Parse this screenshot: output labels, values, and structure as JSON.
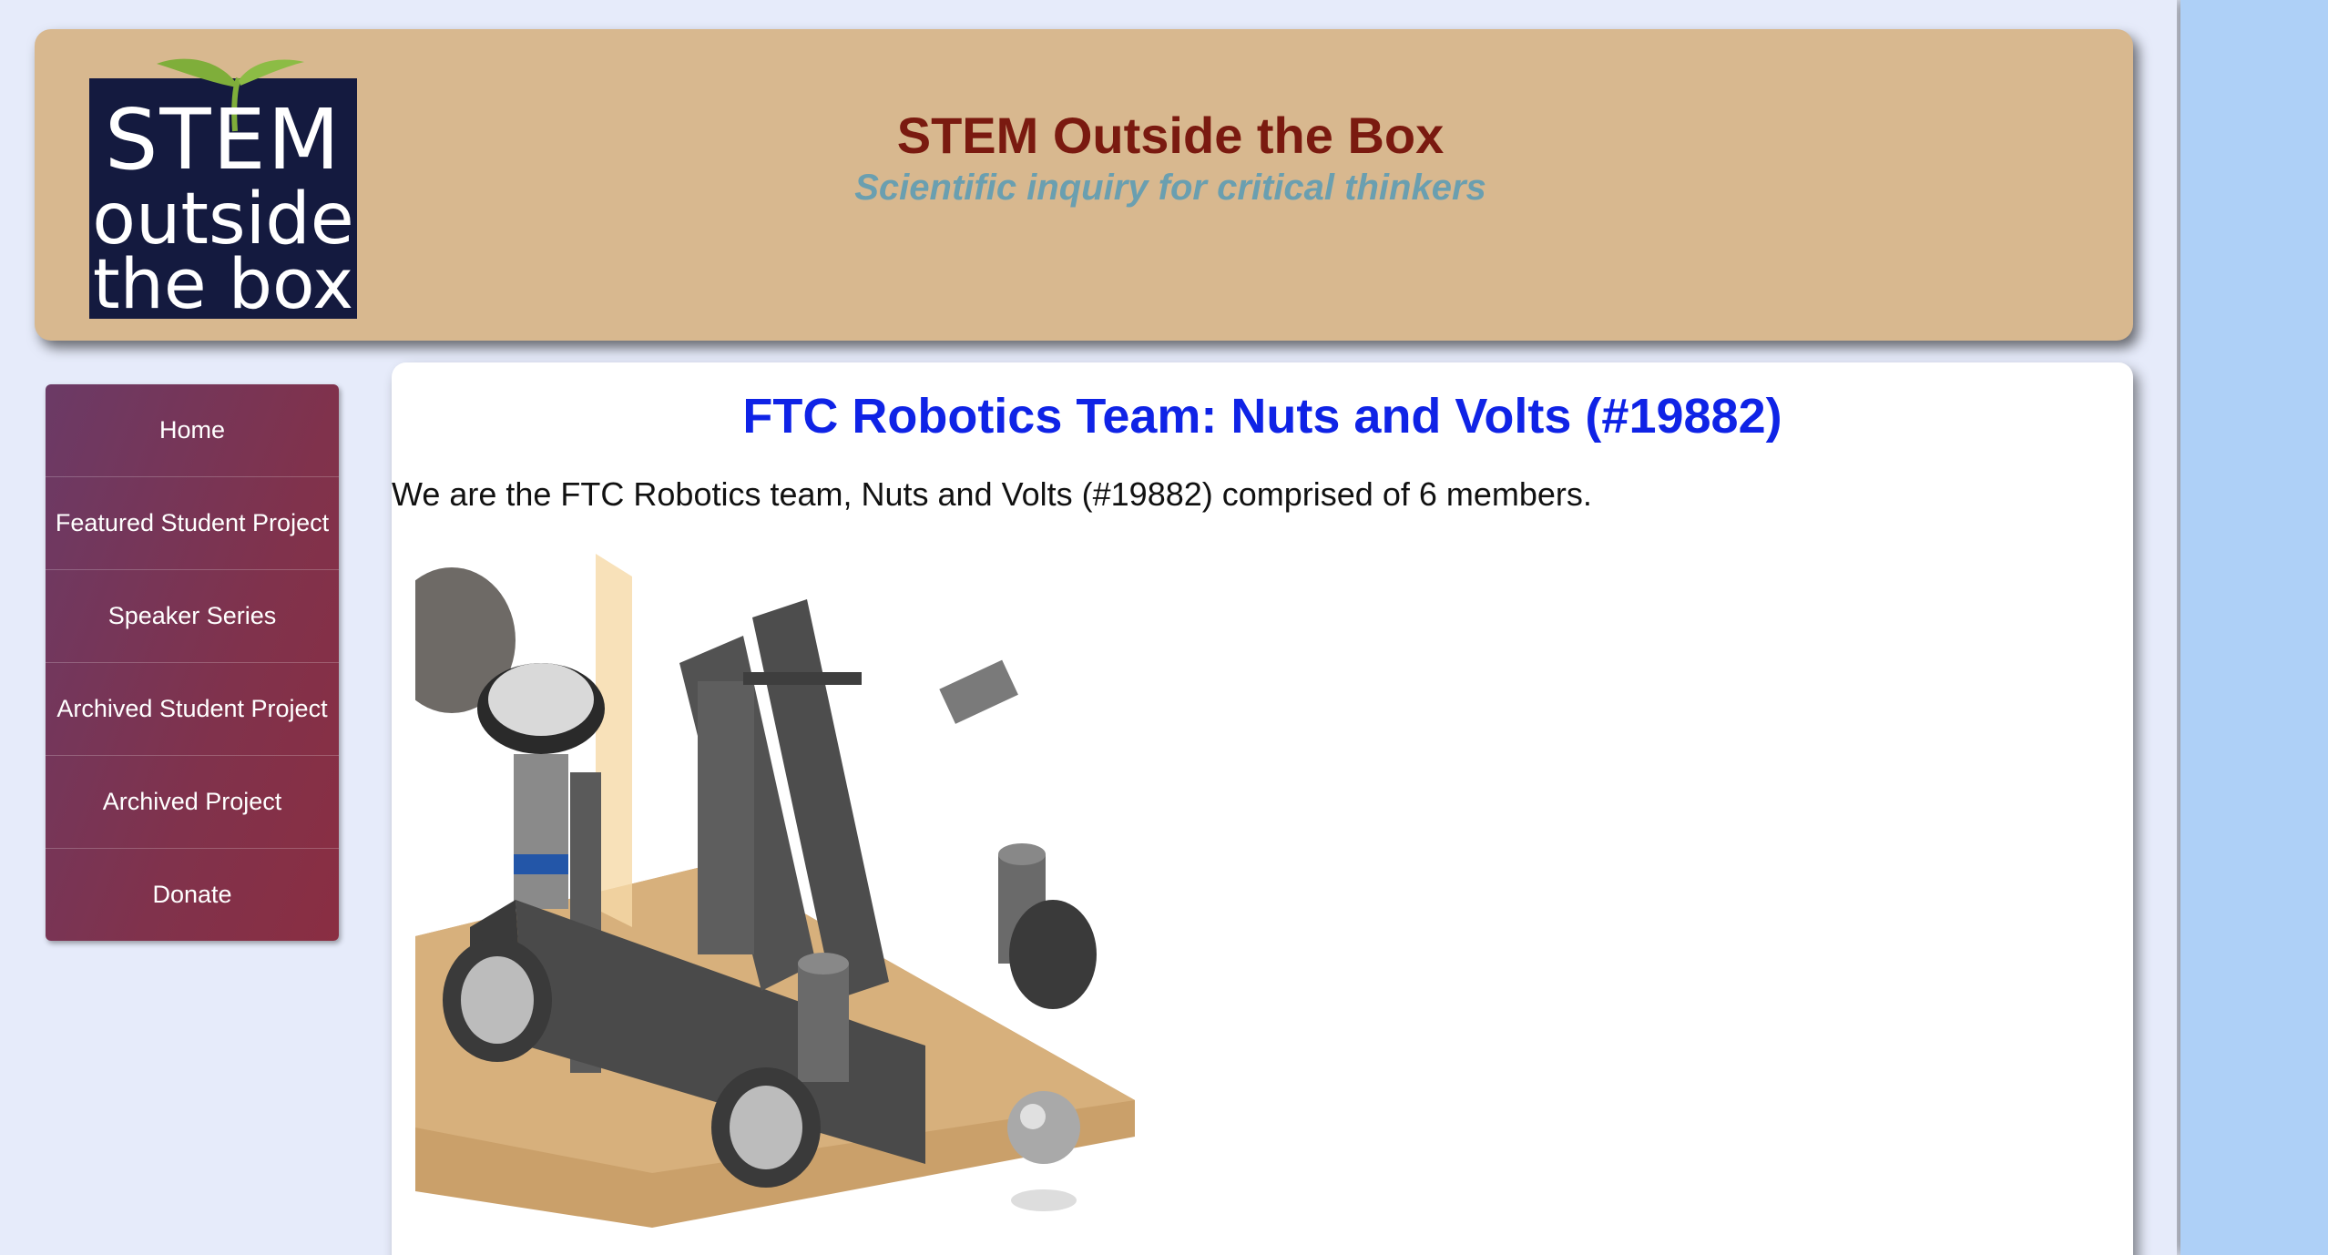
{
  "header": {
    "logo": {
      "line1": "STEM",
      "line2": "outside",
      "line3": "the box"
    },
    "title": "STEM Outside the Box",
    "tagline": "Scientific inquiry for critical thinkers"
  },
  "sidebar": {
    "items": [
      {
        "label": "Home"
      },
      {
        "label": "Featured Student Project"
      },
      {
        "label": "Speaker Series"
      },
      {
        "label": "Archived Student Project"
      },
      {
        "label": "Archived Project"
      },
      {
        "label": "Donate"
      }
    ]
  },
  "main": {
    "title": "FTC Robotics Team: Nuts and Volts (#19882)",
    "intro": "We are the FTC Robotics team, Nuts and Volts (#19882) comprised of 6 members."
  },
  "colors": {
    "header_bg": "#d8b88f",
    "title": "#7a1a10",
    "tagline": "#6a9fb0",
    "main_title": "#0f23e6",
    "nav_bg": "#80324c",
    "page_bg": "#e6ebfa",
    "right_bg": "#aed0f7"
  }
}
